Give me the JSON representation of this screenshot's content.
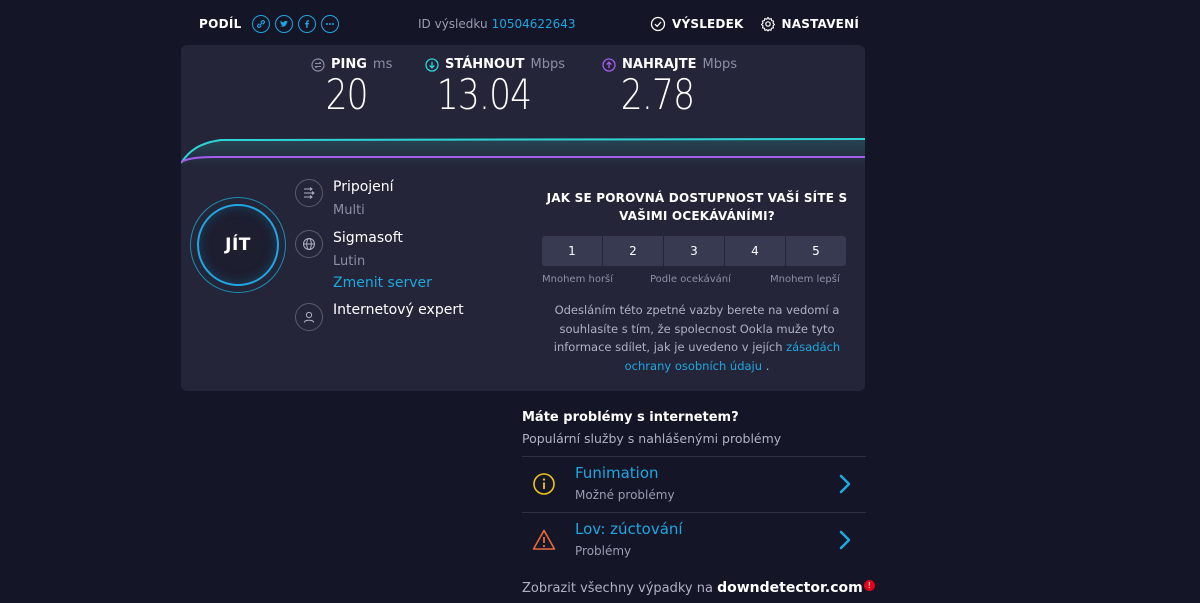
{
  "header": {
    "share_label": "PODÍL",
    "result_id_label": "ID výsledku",
    "result_id_value": "10504622643",
    "results_label": "VÝSLEDEK",
    "settings_label": "NASTAVENÍ"
  },
  "metrics": {
    "ping": {
      "label": "PING",
      "unit": "ms",
      "value": "20"
    },
    "download": {
      "label": "STÁHNOUT",
      "unit": "Mbps",
      "value": "13.04"
    },
    "upload": {
      "label": "NAHRAJTE",
      "unit": "Mbps",
      "value": "2.78"
    }
  },
  "go_label": "JÍT",
  "connection": {
    "label": "Pripojení",
    "value": "Multi",
    "isp": "Sigmasoft",
    "location": "Lutin",
    "change_server": "Zmenit server",
    "provider": "Internetový expert"
  },
  "rating": {
    "question": "JAK SE POROVNÁ DOSTUPNOST VAŠÍ SÍTE S VAŠIMI OCEKÁVÁNÍMI?",
    "options": [
      "1",
      "2",
      "3",
      "4",
      "5"
    ],
    "low_label": "Mnohem horší",
    "mid_label": "Podle ocekávání",
    "high_label": "Mnohem lepší",
    "disclaimer_text": "Odesláním této zpetné vazby berete na vedomí a souhlasíte s tím, že spolecnost Ookla muže tyto informace sdílet, jak je uvedeno v jejích",
    "privacy_link": "zásadách ochrany osobních údaju",
    "disclaimer_end": "."
  },
  "problems": {
    "title": "Máte problémy s internetem?",
    "subtitle": "Populární služby s nahlášenými problémy",
    "items": [
      {
        "name": "Funimation",
        "status": "Možné problémy",
        "icon": "info-circle-icon"
      },
      {
        "name": "Lov: zúctování",
        "status": "Problémy",
        "icon": "warning-triangle-icon"
      }
    ],
    "all_outages_text": "Zobrazit všechny výpadky na",
    "brand": "downdetector.com",
    "brand_badge": "!"
  },
  "colors": {
    "background": "#141526",
    "panel": "#242538",
    "accent": "#1ea7e1",
    "download": "#2ed4d4",
    "upload": "#a55cf0",
    "warning": "#e86c3a",
    "info": "#f0c419"
  }
}
